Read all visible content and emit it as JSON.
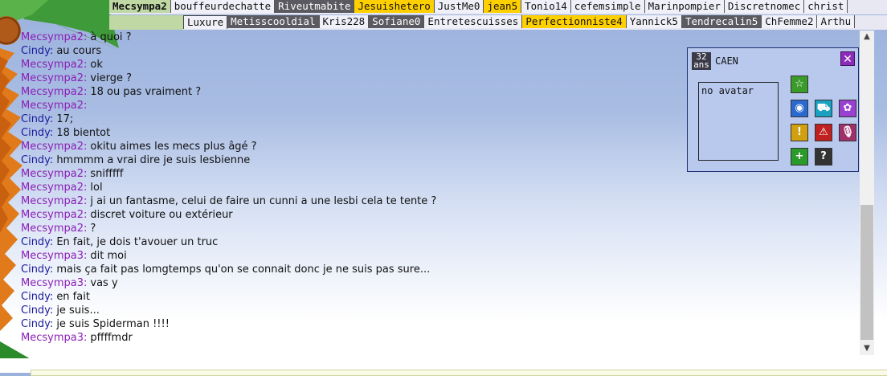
{
  "tabs_row1": [
    {
      "label": "Mecsympa2",
      "style": "active"
    },
    {
      "label": "bouffeurdechatte",
      "style": "light"
    },
    {
      "label": "Riveutmabite",
      "style": "dark"
    },
    {
      "label": "Jesuishetero",
      "style": "yellow"
    },
    {
      "label": "JustMe0",
      "style": "light"
    },
    {
      "label": "jean5",
      "style": "yellow"
    },
    {
      "label": "Tonio14",
      "style": "light"
    },
    {
      "label": "cefemsimple",
      "style": "light"
    },
    {
      "label": "Marinpompier",
      "style": "light"
    },
    {
      "label": "Discretnomec",
      "style": "light"
    },
    {
      "label": "christ",
      "style": "light"
    }
  ],
  "tabs_row2": [
    {
      "label": "Luxure",
      "style": "light"
    },
    {
      "label": "Metisscooldial",
      "style": "dark"
    },
    {
      "label": "Kris228",
      "style": "light"
    },
    {
      "label": "Sofiane0",
      "style": "dark"
    },
    {
      "label": "Entretescuisses",
      "style": "light"
    },
    {
      "label": "Perfectionniste4",
      "style": "yellow"
    },
    {
      "label": "Yannick5",
      "style": "light"
    },
    {
      "label": "Tendrecalin5",
      "style": "dark"
    },
    {
      "label": "ChFemme2",
      "style": "light"
    },
    {
      "label": "Arthu",
      "style": "light"
    }
  ],
  "chat": {
    "messages": [
      {
        "nick": "Mecsympa2:",
        "color": "purple",
        "text": "à quoi ?"
      },
      {
        "nick": "Cindy:",
        "color": "blue",
        "text": "au cours"
      },
      {
        "nick": "Mecsympa2:",
        "color": "purple",
        "text": "ok"
      },
      {
        "nick": "Mecsympa2:",
        "color": "purple",
        "text": "vierge ?"
      },
      {
        "nick": "Mecsympa2:",
        "color": "purple",
        "text": "18 ou pas vraiment ?"
      },
      {
        "nick": "Mecsympa2:",
        "color": "purple",
        "text": ""
      },
      {
        "nick": "Cindy:",
        "color": "blue",
        "text": "17;"
      },
      {
        "nick": "Cindy:",
        "color": "blue",
        "text": "18 bientot"
      },
      {
        "nick": "Mecsympa2:",
        "color": "purple",
        "text": "okitu aimes les mecs plus âgé ?"
      },
      {
        "nick": "Cindy:",
        "color": "blue",
        "text": "hmmmm a vrai dire je suis lesbienne"
      },
      {
        "nick": "Mecsympa2:",
        "color": "purple",
        "text": "snifffff"
      },
      {
        "nick": "Mecsympa2:",
        "color": "purple",
        "text": "lol"
      },
      {
        "nick": "Mecsympa2:",
        "color": "purple",
        "text": "j ai un fantasme, celui de faire un cunni a une lesbi cela te tente ?"
      },
      {
        "nick": "Mecsympa2:",
        "color": "purple",
        "text": "discret voiture ou extérieur"
      },
      {
        "nick": "Mecsympa2:",
        "color": "purple",
        "text": "?"
      },
      {
        "nick": "Cindy:",
        "color": "blue",
        "text": "En fait, je dois t'avouer un truc"
      },
      {
        "nick": "Mecsympa3:",
        "color": "purple",
        "text": "dit moi"
      },
      {
        "nick": "Cindy:",
        "color": "blue",
        "text": "mais ça fait pas lomgtemps qu'on se connait donc je ne suis pas sure..."
      },
      {
        "nick": "Mecsympa3:",
        "color": "purple",
        "text": "vas y"
      },
      {
        "nick": "Cindy:",
        "color": "blue",
        "text": "en fait"
      },
      {
        "nick": "Cindy:",
        "color": "blue",
        "text": "je suis..."
      },
      {
        "nick": "Cindy:",
        "color": "blue",
        "text": "je suis Spiderman !!!!"
      },
      {
        "nick": "Mecsympa3:",
        "color": "purple",
        "text": "pffffmdr"
      }
    ]
  },
  "profile": {
    "age_number": "32",
    "age_unit": "ans",
    "city": "CAEN",
    "close_label": "✕",
    "avatar_text": "no avatar",
    "buttons": [
      {
        "name": "favorite-star-icon",
        "glyph": "☆",
        "color": "#3a9a2a"
      },
      {
        "name": "webcam-icon",
        "glyph": "◉",
        "color": "#2a6ad0"
      },
      {
        "name": "car-icon",
        "glyph": "⛟",
        "color": "#1aa0c0"
      },
      {
        "name": "flower-icon",
        "glyph": "✿",
        "color": "#9a40d0"
      },
      {
        "name": "info-icon",
        "glyph": "!",
        "color": "#d0a010"
      },
      {
        "name": "warning-icon",
        "glyph": "⚠",
        "color": "#c02020"
      },
      {
        "name": "microphone-icon",
        "glyph": "🎙",
        "color": "#a0306a"
      },
      {
        "name": "add-icon",
        "glyph": "+",
        "color": "#2a9a2a"
      },
      {
        "name": "help-icon",
        "glyph": "?",
        "color": "#333333"
      }
    ]
  },
  "colors": {
    "nick_purple": "#8a1fb5",
    "nick_blue": "#1a1a9a",
    "tab_yellow": "#ffd000",
    "tab_dark": "#5a5a60",
    "tab_active": "#bfd8a4"
  }
}
